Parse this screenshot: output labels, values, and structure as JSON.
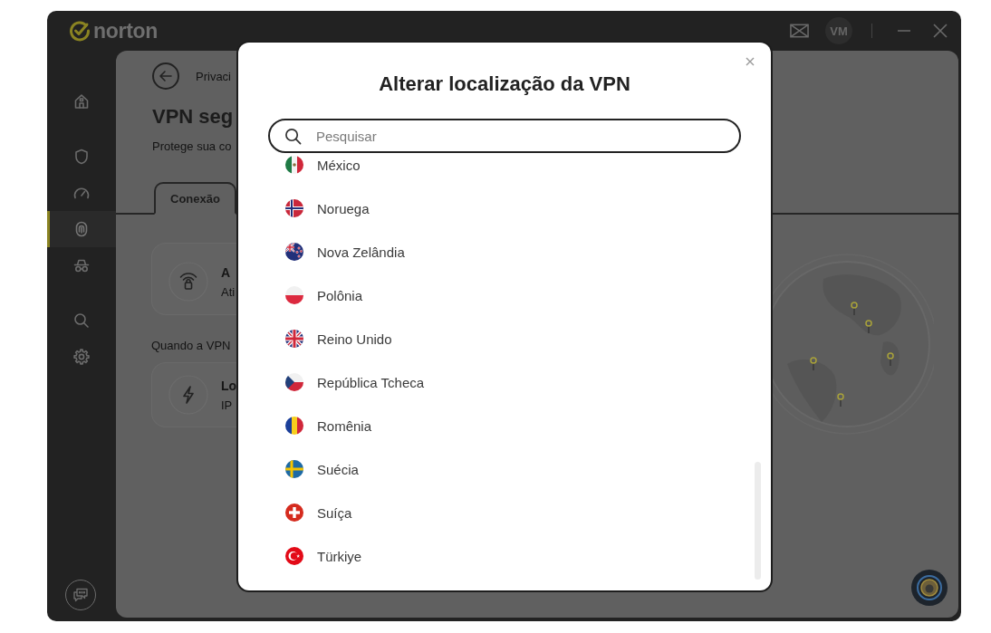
{
  "title_bar": {
    "logo": "norton",
    "avatar": "VM"
  },
  "sidebar": {
    "groups": [
      {
        "items": [
          {
            "selected": false
          }
        ]
      },
      {
        "items": [
          {
            "selected": false
          },
          {
            "selected": false
          },
          {
            "selected": true
          },
          {
            "selected": false
          }
        ]
      },
      {
        "items": [
          {
            "selected": false
          },
          {
            "selected": false
          }
        ]
      }
    ]
  },
  "page": {
    "breadcrumb": "Privaci",
    "title": "VPN seg",
    "subtitle": "Protege sua co",
    "tabs": [
      {
        "label": "Conexão",
        "selected": true
      }
    ],
    "cards": [
      {
        "title": "A",
        "subtitle": "Ati"
      }
    ],
    "section": {
      "label": "Quando a VPN",
      "cards": [
        {
          "title": "Lo",
          "subtitle": "IP"
        }
      ]
    }
  },
  "dialog": {
    "title": "Alterar localização da VPN",
    "search": {
      "placeholder": "Pesquisar"
    },
    "countries": [
      "México",
      "Noruega",
      "Nova Zelândia",
      "Polônia",
      "Reino Unido",
      "República Tcheca",
      "Romênia",
      "Suécia",
      "Suíça",
      "Türkiye"
    ]
  }
}
